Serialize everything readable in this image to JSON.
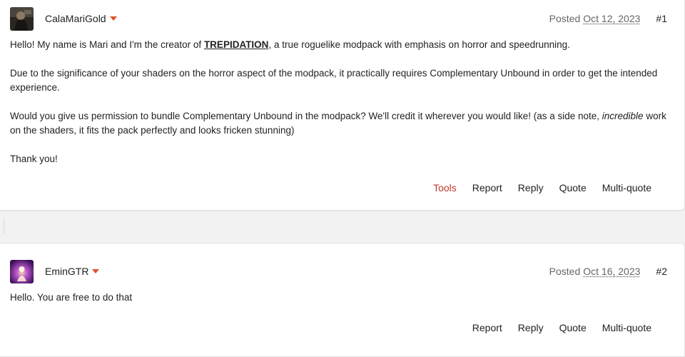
{
  "posts": [
    {
      "author": "CalaMariGold",
      "posted_label": "Posted",
      "date": "Oct 12, 2023",
      "number": "#1",
      "body": {
        "p1_before": "Hello! My name is Mari and I'm the creator of ",
        "p1_link": "TREPIDATION",
        "p1_after": ", a true roguelike modpack with emphasis on horror and speedrunning.",
        "p2": "Due to the significance of your shaders on the horror aspect of the modpack, it practically requires Complementary Unbound in order to get the intended experience.",
        "p3_before": "Would you give us permission to bundle Complementary Unbound in the modpack? We'll credit it wherever you would like! (as a side note, ",
        "p3_em": "incredible",
        "p3_after": " work on the shaders, it fits the pack perfectly and looks fricken stunning)",
        "p4": "Thank you!"
      },
      "actions": [
        "Tools",
        "Report",
        "Reply",
        "Quote",
        "Multi-quote"
      ]
    },
    {
      "author": "EminGTR",
      "posted_label": "Posted",
      "date": "Oct 16, 2023",
      "number": "#2",
      "body": {
        "p1": "Hello. You are free to do that"
      },
      "actions": [
        "Report",
        "Reply",
        "Quote",
        "Multi-quote"
      ]
    }
  ],
  "colors": {
    "accent_caret": "#e0502a",
    "tools_link": "#c0392b"
  },
  "icons": {
    "author_menu": "caret-down-icon"
  }
}
